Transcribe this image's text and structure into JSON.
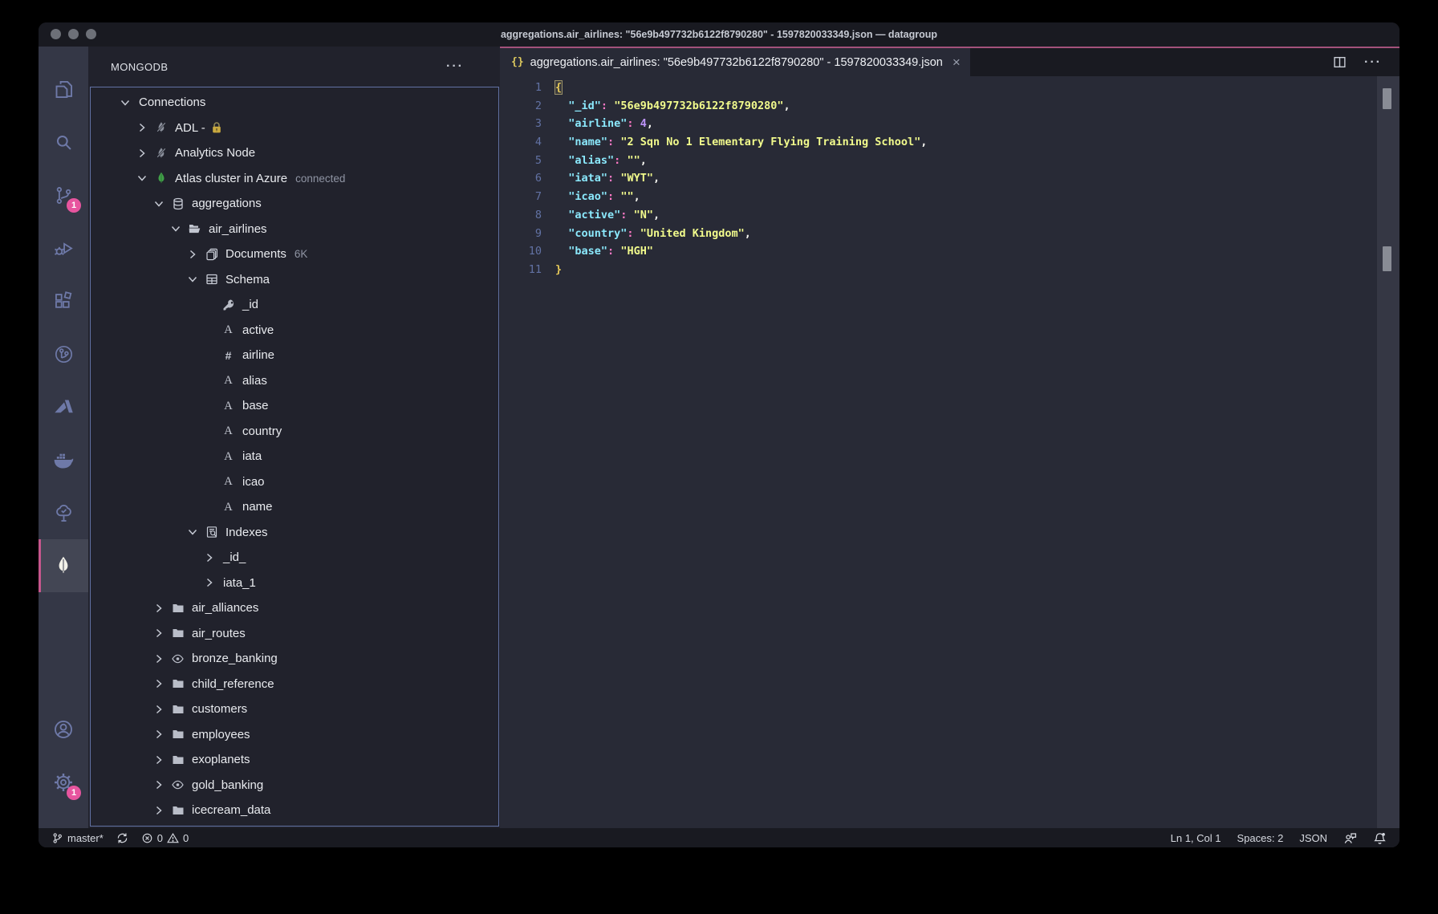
{
  "window": {
    "title": "aggregations.air_airlines: \"56e9b497732b6122f8790280\" - 1597820033349.json — datagroup"
  },
  "colors": {
    "accent_pink": "#ff79c6",
    "badge_pink": "#e7559f",
    "mongodb_green": "#41a048",
    "focus_border_blue": "#6272a4",
    "syntax_key": "#8be9fd",
    "syntax_separator": "#ff79c6",
    "syntax_string": "#f1fa8c",
    "syntax_number": "#bd93f9",
    "bracket_gold": "#e8cb5a"
  },
  "activity_bar": {
    "items": [
      {
        "name": "explorer"
      },
      {
        "name": "search"
      },
      {
        "name": "source-control",
        "badge": "1"
      },
      {
        "name": "run-and-debug"
      },
      {
        "name": "extensions"
      },
      {
        "name": "git-graph"
      },
      {
        "name": "azure"
      },
      {
        "name": "docker"
      },
      {
        "name": "test-tree"
      },
      {
        "name": "mongodb",
        "active": true
      }
    ],
    "bottom_items": [
      {
        "name": "accounts"
      },
      {
        "name": "settings",
        "badge": "1"
      }
    ]
  },
  "sidebar": {
    "title": "MONGODB",
    "more_actions_glyph": "···",
    "tree": [
      {
        "label": "Connections",
        "level": 0,
        "chevron": "expanded"
      },
      {
        "label": "ADL -",
        "level": 1,
        "chevron": "collapsed",
        "icon": "leaf-disconnected",
        "suffix_icon": "lock"
      },
      {
        "label": "Analytics Node",
        "level": 1,
        "chevron": "collapsed",
        "icon": "leaf-disconnected"
      },
      {
        "label": "Atlas cluster in Azure",
        "level": 1,
        "chevron": "expanded",
        "icon": "leaf-connected",
        "meta": "connected"
      },
      {
        "label": "aggregations",
        "level": 2,
        "chevron": "expanded",
        "icon": "database"
      },
      {
        "label": "air_airlines",
        "level": 3,
        "chevron": "expanded",
        "icon": "folder-open"
      },
      {
        "label": "Documents",
        "level": 4,
        "chevron": "collapsed",
        "icon": "documents",
        "meta": "6K"
      },
      {
        "label": "Schema",
        "level": 4,
        "chevron": "expanded",
        "icon": "schema"
      },
      {
        "label": "_id",
        "level": 5,
        "icon": "key"
      },
      {
        "label": "active",
        "level": 5,
        "icon": "string"
      },
      {
        "label": "airline",
        "level": 5,
        "icon": "number"
      },
      {
        "label": "alias",
        "level": 5,
        "icon": "string"
      },
      {
        "label": "base",
        "level": 5,
        "icon": "string"
      },
      {
        "label": "country",
        "level": 5,
        "icon": "string"
      },
      {
        "label": "iata",
        "level": 5,
        "icon": "string"
      },
      {
        "label": "icao",
        "level": 5,
        "icon": "string"
      },
      {
        "label": "name",
        "level": 5,
        "icon": "string"
      },
      {
        "label": "Indexes",
        "level": 4,
        "chevron": "expanded",
        "icon": "indexes"
      },
      {
        "label": "_id_",
        "level": 5,
        "chevron": "collapsed"
      },
      {
        "label": "iata_1",
        "level": 5,
        "chevron": "collapsed"
      },
      {
        "label": "air_alliances",
        "level": 2,
        "chevron": "collapsed",
        "icon": "folder"
      },
      {
        "label": "air_routes",
        "level": 2,
        "chevron": "collapsed",
        "icon": "folder"
      },
      {
        "label": "bronze_banking",
        "level": 2,
        "chevron": "collapsed",
        "icon": "eye"
      },
      {
        "label": "child_reference",
        "level": 2,
        "chevron": "collapsed",
        "icon": "folder"
      },
      {
        "label": "customers",
        "level": 2,
        "chevron": "collapsed",
        "icon": "folder"
      },
      {
        "label": "employees",
        "level": 2,
        "chevron": "collapsed",
        "icon": "folder"
      },
      {
        "label": "exoplanets",
        "level": 2,
        "chevron": "collapsed",
        "icon": "folder"
      },
      {
        "label": "gold_banking",
        "level": 2,
        "chevron": "collapsed",
        "icon": "eye"
      },
      {
        "label": "icecream_data",
        "level": 2,
        "chevron": "collapsed",
        "icon": "folder"
      }
    ]
  },
  "editor": {
    "tab": {
      "icon_glyph": "{}",
      "label": "aggregations.air_airlines: \"56e9b497732b6122f8790280\" - 1597820033349.json",
      "close_glyph": "×"
    },
    "tabbar_more_glyph": "···",
    "lines": [
      {
        "n": "1",
        "t": [
          [
            "brace1m",
            "{"
          ]
        ]
      },
      {
        "n": "2",
        "t": [
          [
            "ws",
            "  "
          ],
          [
            "key",
            "\"_id\""
          ],
          [
            "sep",
            ":"
          ],
          [
            "ws",
            " "
          ],
          [
            "str",
            "\"56e9b497732b6122f8790280\""
          ],
          [
            "punc",
            ","
          ]
        ]
      },
      {
        "n": "3",
        "t": [
          [
            "ws",
            "  "
          ],
          [
            "key",
            "\"airline\""
          ],
          [
            "sep",
            ":"
          ],
          [
            "ws",
            " "
          ],
          [
            "num",
            "4"
          ],
          [
            "punc",
            ","
          ]
        ]
      },
      {
        "n": "4",
        "t": [
          [
            "ws",
            "  "
          ],
          [
            "key",
            "\"name\""
          ],
          [
            "sep",
            ":"
          ],
          [
            "ws",
            " "
          ],
          [
            "str",
            "\"2 Sqn No 1 Elementary Flying Training School\""
          ],
          [
            "punc",
            ","
          ]
        ]
      },
      {
        "n": "5",
        "t": [
          [
            "ws",
            "  "
          ],
          [
            "key",
            "\"alias\""
          ],
          [
            "sep",
            ":"
          ],
          [
            "ws",
            " "
          ],
          [
            "str",
            "\"\""
          ],
          [
            "punc",
            ","
          ]
        ]
      },
      {
        "n": "6",
        "t": [
          [
            "ws",
            "  "
          ],
          [
            "key",
            "\"iata\""
          ],
          [
            "sep",
            ":"
          ],
          [
            "ws",
            " "
          ],
          [
            "str",
            "\"WYT\""
          ],
          [
            "punc",
            ","
          ]
        ]
      },
      {
        "n": "7",
        "t": [
          [
            "ws",
            "  "
          ],
          [
            "key",
            "\"icao\""
          ],
          [
            "sep",
            ":"
          ],
          [
            "ws",
            " "
          ],
          [
            "str",
            "\"\""
          ],
          [
            "punc",
            ","
          ]
        ]
      },
      {
        "n": "8",
        "t": [
          [
            "ws",
            "  "
          ],
          [
            "key",
            "\"active\""
          ],
          [
            "sep",
            ":"
          ],
          [
            "ws",
            " "
          ],
          [
            "str",
            "\"N\""
          ],
          [
            "punc",
            ","
          ]
        ]
      },
      {
        "n": "9",
        "t": [
          [
            "ws",
            "  "
          ],
          [
            "key",
            "\"country\""
          ],
          [
            "sep",
            ":"
          ],
          [
            "ws",
            " "
          ],
          [
            "str",
            "\"United Kingdom\""
          ],
          [
            "punc",
            ","
          ]
        ]
      },
      {
        "n": "10",
        "t": [
          [
            "ws",
            "  "
          ],
          [
            "key",
            "\"base\""
          ],
          [
            "sep",
            ":"
          ],
          [
            "ws",
            " "
          ],
          [
            "str",
            "\"HGH\""
          ]
        ]
      },
      {
        "n": "11",
        "t": [
          [
            "brace1",
            "}"
          ]
        ]
      }
    ]
  },
  "status_bar": {
    "branch": "master*",
    "errors": "0",
    "warnings": "0",
    "cursor_position": "Ln 1, Col 1",
    "indentation": "Spaces: 2",
    "language": "JSON"
  }
}
